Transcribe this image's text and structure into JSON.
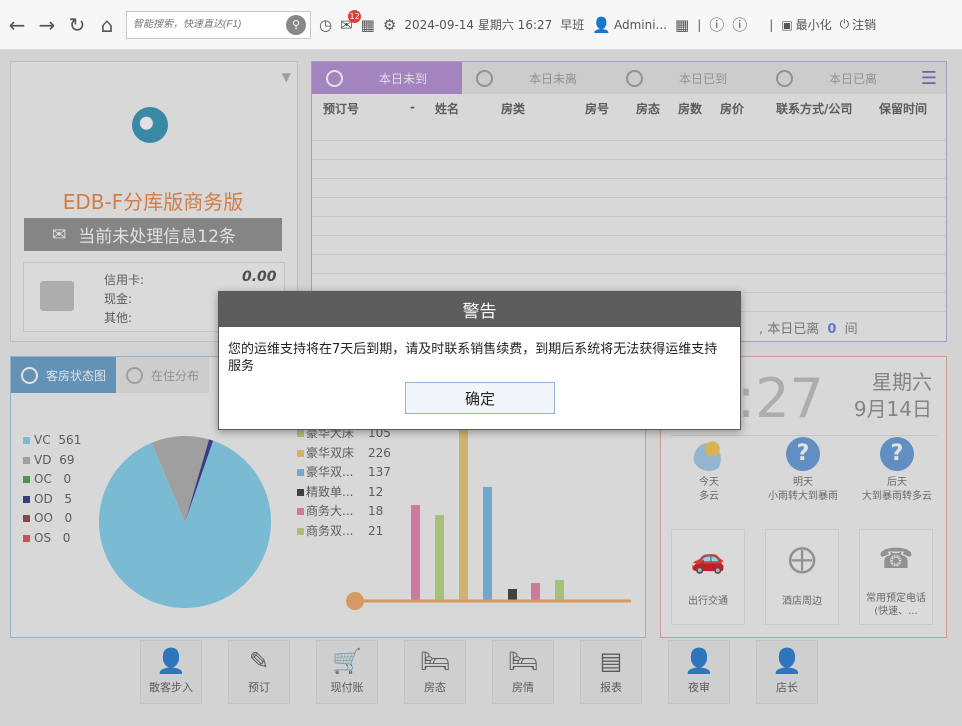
{
  "toolbar": {
    "search_placeholder": "智能搜索，快速直达(F1)",
    "notification_count": "12",
    "datetime": "2024-09-14 星期六 16:27",
    "shift": "早班",
    "user": "Admini...",
    "minimize_label": "最小化",
    "logout_label": "注销"
  },
  "info_panel": {
    "product_name": "EDB-F分库版商务版",
    "message_button": "当前未处理信息12条",
    "payments": [
      {
        "label": "信用卡:",
        "value": "0.00"
      },
      {
        "label": "现金:",
        "value": ""
      },
      {
        "label": "其他:",
        "value": ""
      }
    ]
  },
  "arrivals_panel": {
    "tabs": [
      "本日未到",
      "本日未离",
      "本日已到",
      "本日已离"
    ],
    "columns": [
      "预订号",
      "-",
      "姓名",
      "房类",
      "房号",
      "房态",
      "房数",
      "房价",
      "联系方式/公司",
      "保留时间"
    ],
    "footer_text": ", 本日已离",
    "footer_count": "0",
    "footer_unit": "间"
  },
  "room_status_panel": {
    "tabs": [
      "客房状态图",
      "在住分布"
    ],
    "pie_legend": [
      {
        "code": "VC",
        "value": "561",
        "color": "#7ccfee"
      },
      {
        "code": "VD",
        "value": "69",
        "color": "#ababab"
      },
      {
        "code": "OC",
        "value": "0",
        "color": "#3aa048"
      },
      {
        "code": "OD",
        "value": "5",
        "color": "#2a2a8a"
      },
      {
        "code": "OO",
        "value": "0",
        "color": "#8b3a3a"
      },
      {
        "code": "OS",
        "value": "0",
        "color": "#e24848"
      }
    ],
    "bar_legend": [
      {
        "name": "豪华大床",
        "value": "105",
        "color": "#b5d67c"
      },
      {
        "name": "豪华双床",
        "value": "226",
        "color": "#e7c46c"
      },
      {
        "name": "豪华双...",
        "value": "137",
        "color": "#6fb6e8"
      },
      {
        "name": "精致单...",
        "value": "12",
        "color": "#333333"
      },
      {
        "name": "商务大...",
        "value": "18",
        "color": "#e77ba7"
      },
      {
        "name": "商务双...",
        "value": "21",
        "color": "#b5d67c"
      }
    ]
  },
  "chart_data": [
    {
      "type": "pie",
      "categories": [
        "VC",
        "VD",
        "OC",
        "OD",
        "OO",
        "OS"
      ],
      "values": [
        561,
        69,
        0,
        5,
        0,
        0
      ]
    },
    {
      "type": "bar",
      "categories": [
        "商务大...",
        "商务双...",
        "豪华双床",
        "豪华双...",
        "精致单...",
        "商务大...",
        "商务双..."
      ],
      "values": [
        96,
        86,
        226,
        114,
        12,
        18,
        21
      ]
    }
  ],
  "clock_panel": {
    "time": ":27",
    "weekday": "星期六",
    "date": "9月14日",
    "weather": [
      {
        "day": "今天",
        "desc": "多云"
      },
      {
        "day": "明天",
        "desc": "小雨转大到暴雨"
      },
      {
        "day": "后天",
        "desc": "大到暴雨转多云"
      }
    ],
    "tiles": [
      "出行交通",
      "酒店周边",
      "常用预定电话 (快速、..."
    ]
  },
  "bottom_tools": [
    "散客步入",
    "预订",
    "现付账",
    "房态",
    "房情",
    "报表",
    "夜审",
    "店长"
  ],
  "dialog": {
    "title": "警告",
    "message": "您的运维支持将在7天后到期，请及时联系销售续费，到期后系统将无法获得运维支持服务",
    "confirm": "确定"
  }
}
